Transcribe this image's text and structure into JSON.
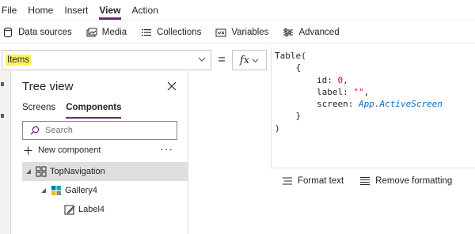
{
  "menu": [
    "File",
    "Home",
    "Insert",
    "View",
    "Action"
  ],
  "menu_active": "View",
  "toolbar": {
    "data_sources": "Data sources",
    "media": "Media",
    "collections": "Collections",
    "variables": "Variables",
    "advanced": "Advanced"
  },
  "formula": {
    "property": "Items",
    "equals": "=",
    "fx": "fx"
  },
  "code": {
    "l1": "Table(",
    "l2": "{",
    "id_key": "id: ",
    "id_val": "0",
    "id_comma": ",",
    "label_key": "label: ",
    "label_val": "\"\"",
    "label_comma": ",",
    "screen_key": "screen: ",
    "screen_val": "App.ActiveScreen",
    "l6": "}",
    "l7": ")"
  },
  "editor_footer": {
    "format_text": "Format text",
    "remove_formatting": "Remove formatting"
  },
  "tree": {
    "title": "Tree view",
    "tabs": [
      "Screens",
      "Components"
    ],
    "active_tab": "Components",
    "search_placeholder": "Search",
    "new_component": "New component",
    "more": "···",
    "nodes": [
      {
        "label": "TopNavigation"
      },
      {
        "label": "Gallery4"
      },
      {
        "label": "Label4"
      }
    ]
  },
  "colors": {
    "accent": "#742774",
    "highlight": "#fff35a",
    "selected_row": "#e1dfdd"
  }
}
